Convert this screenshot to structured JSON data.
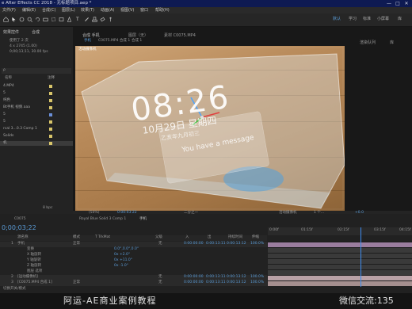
{
  "app": {
    "title": "e After Effects CC 2018 - 无标题项目.aep *",
    "window_controls": [
      "—",
      "□",
      "✕"
    ],
    "menu": [
      "文件(F)",
      "编辑(E)",
      "合成(C)",
      "图层(L)",
      "效果(T)",
      "动画(A)",
      "视图(V)",
      "窗口",
      "帮助(H)"
    ],
    "workspaces": [
      "默认",
      "学习",
      "标准",
      "小屏幕",
      "库"
    ]
  },
  "project": {
    "tabs": [
      "效果控件",
      "合成"
    ],
    "info_lines": [
      "使用了 2 次",
      "4 x 2745 (1.00)",
      "0;00;13;11, 30.00 fps"
    ],
    "search_placeholder": "ρ",
    "header": [
      "名称",
      "注释"
    ],
    "items": [
      {
        "name": "4.MP4",
        "color": "#d8c56a"
      },
      {
        "name": "5",
        "color": "#d8c56a"
      },
      {
        "name": "纯色",
        "color": "#d8c56a"
      },
      {
        "name": "Bt手机 视频.aaa",
        "color": "#d8c56a"
      },
      {
        "name": "5",
        "color": "#6a8fd8"
      },
      {
        "name": "5",
        "color": "#d8c56a"
      },
      {
        "name": "rcal 3...0.3 Comp 1",
        "color": "#d8c56a"
      },
      {
        "name": "Solids",
        "color": "#d8c56a"
      },
      {
        "name": "机",
        "color": "#d8c56a",
        "selected": true
      }
    ],
    "footer_label": "8 bpc"
  },
  "viewer": {
    "tabs": [
      "合成 手机",
      "图层（无）",
      "素材 C0075.MP4"
    ],
    "breadcrumbs": [
      "手机",
      "C0075.MP4 合成 1",
      "合成 1"
    ],
    "right_tabs": [
      "渲染队列",
      "库"
    ],
    "camera_label": "活动摄像机",
    "phone": {
      "time": "08:26",
      "date": "10月29日 星期四",
      "subdate": "乙亥年九月初三",
      "notice": "You have a message"
    },
    "controls": {
      "zoom": "(50%)",
      "timecode": "0:00:03:22",
      "quality": "二分之一",
      "view": "活动摄像机",
      "views": "1 个...",
      "exposure": "+0.0"
    }
  },
  "timeline": {
    "tabs": [
      "C0075",
      "Royal Blue Solid 3 Comp 1",
      "手机"
    ],
    "current_time": "0;00;03;22",
    "columns": [
      "源名称",
      "模式",
      "T TrkMat",
      "父级",
      "入",
      "出",
      "持续时间",
      "伸缩"
    ],
    "ruler": [
      "0:00f",
      "01:15f",
      "02:15f",
      "03:15f",
      "04:15f"
    ],
    "layers": [
      {
        "num": "1",
        "name": "手机",
        "mode": "正常",
        "parent": "无",
        "in": "0:00:00:00",
        "out": "0:00:13:11",
        "dur": "0:00:13:12",
        "stretch": "100.0%",
        "color": "#9a7d9e"
      },
      {
        "num": "",
        "name": "变换",
        "mode": "",
        "parent": "",
        "in": "",
        "out": "",
        "dur": "",
        "stretch": "",
        "value": "0.0°,0.0°,0.0°",
        "color": "#3a3a3a"
      },
      {
        "num": "",
        "name": "X 轴旋转",
        "mode": "",
        "parent": "",
        "in": "",
        "out": "",
        "dur": "",
        "stretch": "",
        "value": "0x +2.0°",
        "color": "#3a3a3a"
      },
      {
        "num": "",
        "name": "Y 轴旋转",
        "mode": "",
        "parent": "",
        "in": "",
        "out": "",
        "dur": "",
        "stretch": "",
        "value": "0x +11.0°",
        "color": "#3a3a3a"
      },
      {
        "num": "",
        "name": "Z 轴旋转",
        "mode": "",
        "parent": "",
        "in": "",
        "out": "",
        "dur": "",
        "stretch": "",
        "value": "0x -1.0°",
        "color": "#3a3a3a"
      },
      {
        "num": "",
        "name": "图层 选项",
        "mode": "",
        "parent": "",
        "in": "",
        "out": "",
        "dur": "",
        "stretch": "",
        "value": "",
        "color": "#3a3a3a"
      },
      {
        "num": "2",
        "name": "[运动摄像机]",
        "mode": "",
        "parent": "无",
        "in": "0:00:00:00",
        "out": "0:00:13:11",
        "dur": "0:00:13:12",
        "stretch": "100.0%",
        "color": "#b9a1a6"
      },
      {
        "num": "3",
        "name": "[C0075.MP4 合成 1]",
        "mode": "正常",
        "parent": "无",
        "in": "0:00:00:00",
        "out": "0:00:13:11",
        "dur": "0:00:13:12",
        "stretch": "100.0%",
        "color": "#a58f8f"
      }
    ],
    "footer": "切换开关/模式"
  },
  "footer": {
    "left": "阿运-AE商业案例教程",
    "right": "微信交流:135"
  }
}
